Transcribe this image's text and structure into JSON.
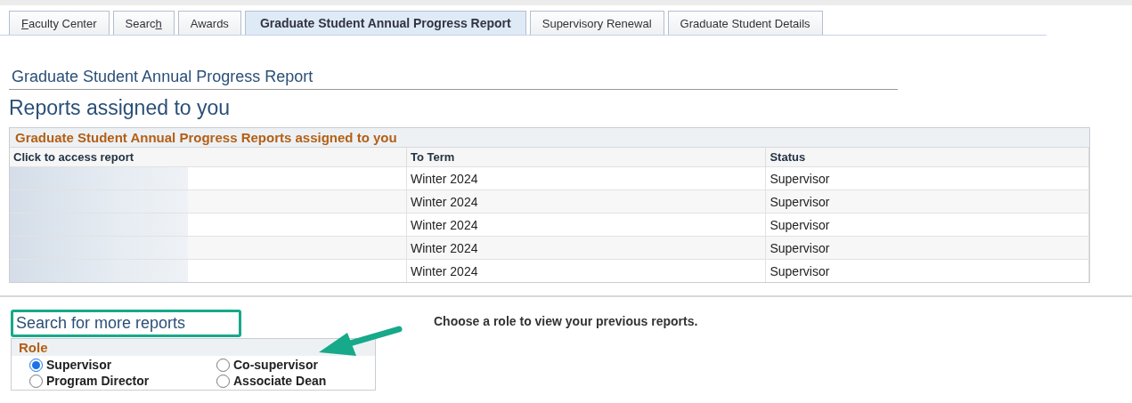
{
  "tabs": [
    {
      "hotkey": "F",
      "after": "aculty Center",
      "selected": false
    },
    {
      "before": "Searc",
      "hotkey": "h",
      "selected": false
    },
    {
      "label": "Awards",
      "selected": false
    },
    {
      "label": "Graduate Student Annual Progress Report",
      "selected": true
    },
    {
      "label": "Supervisory Renewal",
      "selected": false
    },
    {
      "label": "Graduate Student Details",
      "selected": false
    }
  ],
  "page_title": "Graduate Student Annual Progress Report",
  "heading": "Reports assigned to you",
  "table": {
    "title": "Graduate Student Annual Progress Reports assigned to you",
    "columns": [
      "Click to access report",
      "To Term",
      "Status"
    ],
    "rows": [
      {
        "to_term": "Winter 2024",
        "status": "Supervisor"
      },
      {
        "to_term": "Winter 2024",
        "status": "Supervisor"
      },
      {
        "to_term": "Winter 2024",
        "status": "Supervisor"
      },
      {
        "to_term": "Winter 2024",
        "status": "Supervisor"
      },
      {
        "to_term": "Winter 2024",
        "status": "Supervisor"
      }
    ]
  },
  "search_section": {
    "title": "Search for more reports",
    "hint": "Choose a role to view your previous reports.",
    "role_group": {
      "title": "Role",
      "options": [
        {
          "label": "Supervisor",
          "selected": true
        },
        {
          "label": "Co-supervisor",
          "selected": false
        },
        {
          "label": "Program Director",
          "selected": false
        },
        {
          "label": "Associate Dean",
          "selected": false
        }
      ]
    }
  }
}
